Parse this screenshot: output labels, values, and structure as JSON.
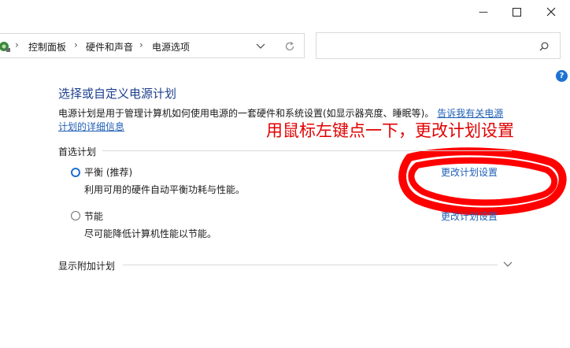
{
  "window": {
    "minimize_glyph": "—",
    "maximize_glyph": "☐",
    "close_glyph": "✕"
  },
  "address_bar": {
    "breadcrumbs": [
      "控制面板",
      "硬件和声音",
      "电源选项"
    ],
    "separator": "›",
    "dropdown_icon": "chevron-down-icon",
    "refresh_icon": "refresh-icon"
  },
  "search": {
    "placeholder": "",
    "icon": "search-icon"
  },
  "page": {
    "title": "选择或自定义电源计划",
    "description": "电源计划是用于管理计算机如何使用电源的一套硬件和系统设置(如显示器亮度、睡眠等)。",
    "description_link": "告诉我有关电源计划的详细信息"
  },
  "preferred": {
    "label": "首选计划",
    "plans": [
      {
        "name": "平衡 (推荐)",
        "desc": "利用可用的硬件自动平衡功耗与性能。",
        "link": "更改计划设置",
        "selected": true
      },
      {
        "name": "节能",
        "desc": "尽可能降低计算机性能以节能。",
        "link": "更改计划设置",
        "selected": false
      }
    ]
  },
  "additional": {
    "label": "显示附加计划"
  },
  "annotation": {
    "text": "用鼠标左键点一下，更改计划设置",
    "color": "#e10000"
  },
  "colors": {
    "link": "#1f5fb5",
    "title": "#1e3f8e",
    "help": "#1e73d2"
  }
}
